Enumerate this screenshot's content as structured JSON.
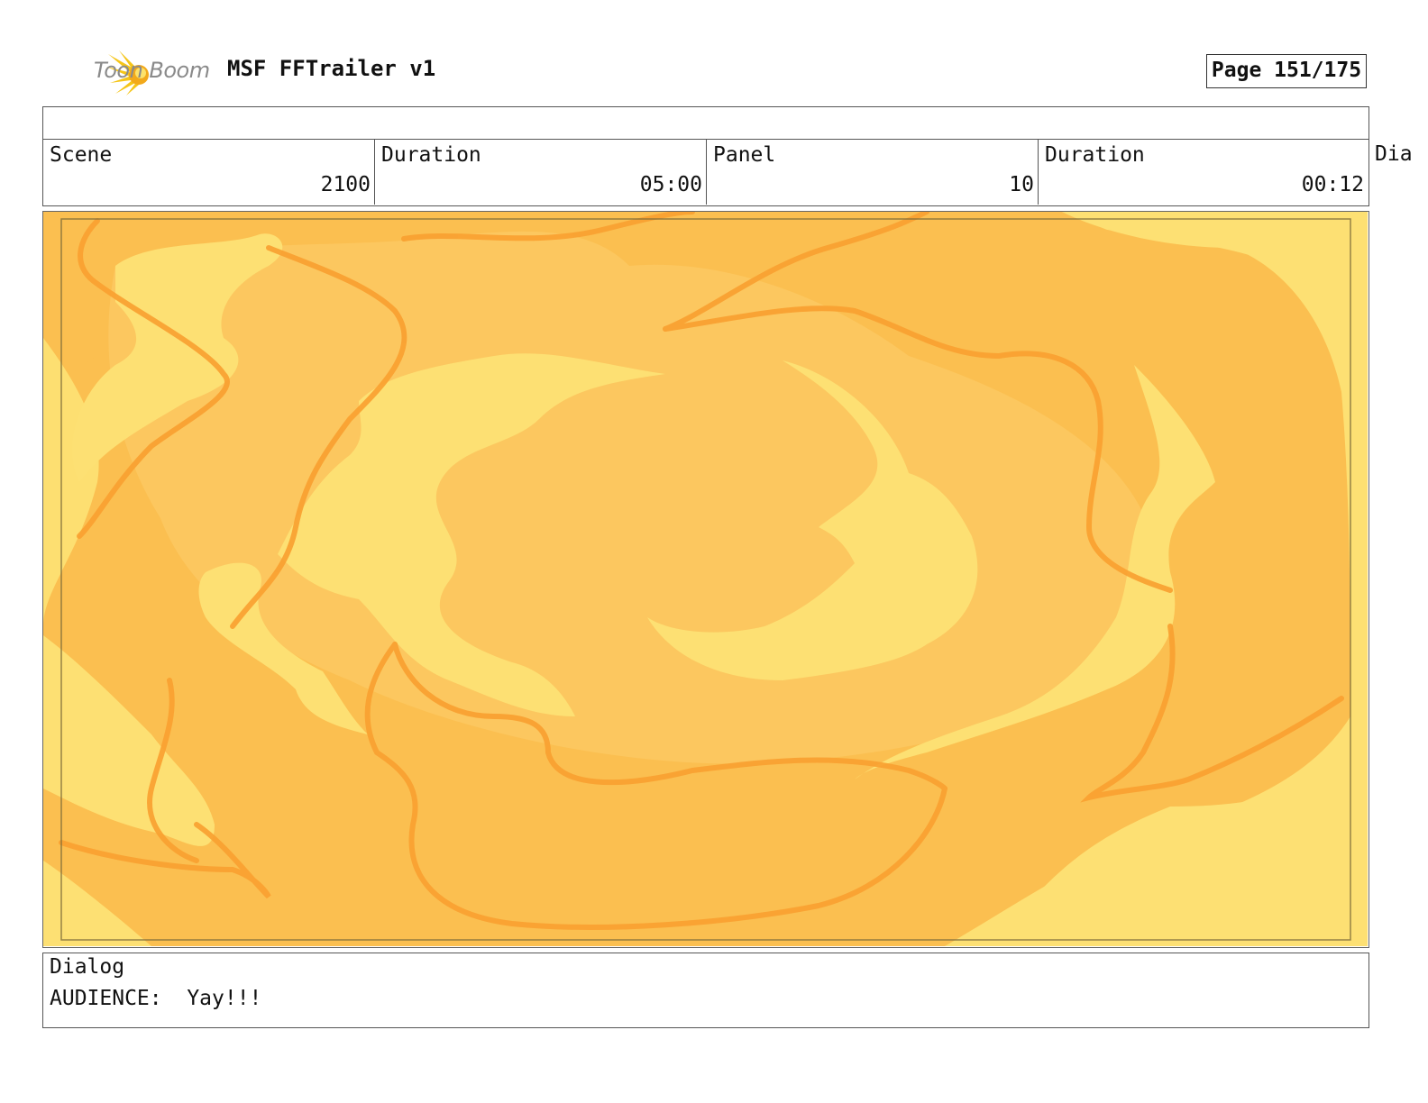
{
  "header": {
    "logo_text": "Toon Boom",
    "project_title": "MSF FFTrailer v1",
    "page_label": "Page 151/175"
  },
  "info": {
    "scene": {
      "label": "Scene",
      "value": "2100"
    },
    "scene_duration": {
      "label": "Duration",
      "value": "05:00"
    },
    "panel": {
      "label": "Panel",
      "value": "10"
    },
    "panel_duration": {
      "label": "Duration",
      "value": "00:12"
    },
    "overflow_label": "Dia"
  },
  "panel_image": {
    "description_colors": {
      "light": "#fde073",
      "mid": "#fbc35c",
      "dark": "#fbb94a",
      "stroke": "#f9a030",
      "frame": "#7a6a3a"
    }
  },
  "dialog": {
    "label": "Dialog",
    "text": "AUDIENCE:  Yay!!!"
  }
}
